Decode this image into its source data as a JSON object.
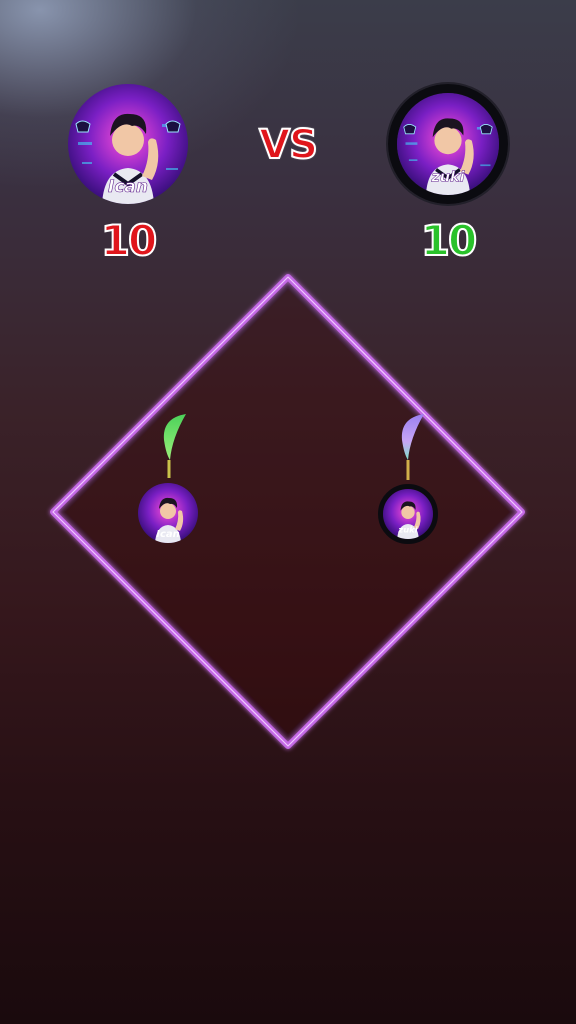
{
  "player1": {
    "name": "Ican",
    "score": "10",
    "score_color": "#e0161c",
    "blade_color": "#4cd15a",
    "avatar_icon": "gamer-boy-avatar"
  },
  "player2": {
    "name": "zuki",
    "score": "10",
    "score_color": "#29c22a",
    "blade_color": "#a98ce6",
    "avatar_icon": "gamer-boy-avatar"
  },
  "vs_label": "VS",
  "arena": {
    "shape": "diamond",
    "border_color": "#c46be6"
  },
  "background": {
    "top": "#3b3d4a",
    "bottom": "#1a0a0d"
  }
}
